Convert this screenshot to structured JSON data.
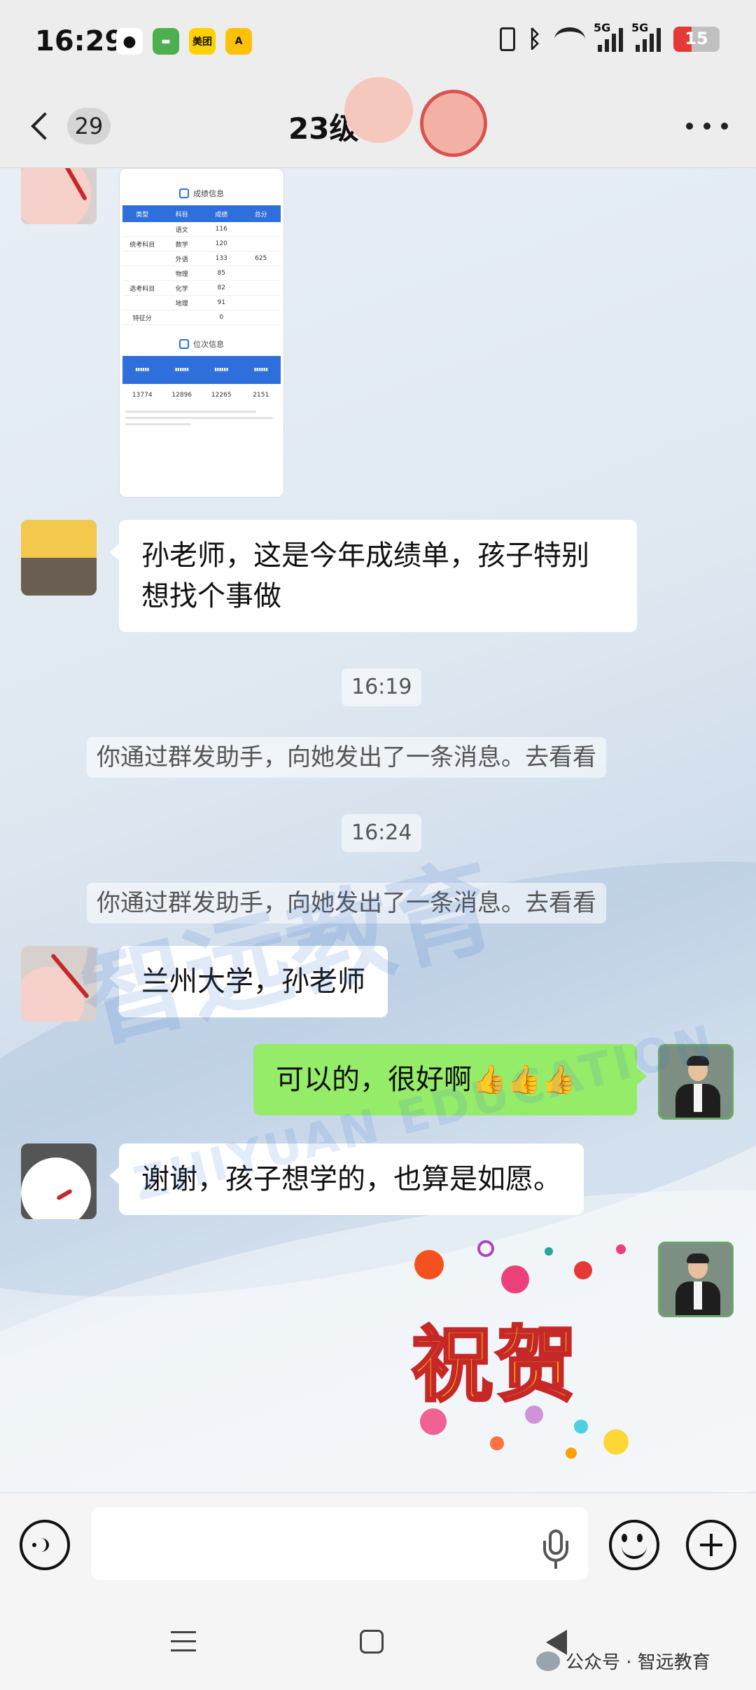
{
  "status_bar": {
    "time": "16:29",
    "apps": [
      "wechat-icon",
      "messages-icon",
      "meituan-icon",
      "app-icon"
    ],
    "meituan_label": "美团",
    "network_1": "5G",
    "network_2": "5G",
    "battery": "15",
    "battery_color": "#e53935"
  },
  "nav": {
    "unread_count": "29",
    "title_partial": "23级"
  },
  "score_sheet": {
    "section_title": "成绩信息",
    "headers": [
      "类型",
      "科目",
      "成绩",
      "总分"
    ],
    "rows": [
      [
        "",
        "语文",
        "116",
        ""
      ],
      [
        "统考科目",
        "数学",
        "120",
        ""
      ],
      [
        "",
        "外语",
        "133",
        "625"
      ],
      [
        "",
        "物理",
        "85",
        ""
      ],
      [
        "选考科目",
        "化学",
        "82",
        ""
      ],
      [
        "",
        "地理",
        "91",
        ""
      ],
      [
        "特征分",
        "",
        "0",
        ""
      ]
    ],
    "rank_title": "位次信息",
    "rank_values": [
      "13774",
      "12896",
      "12265",
      "2151"
    ]
  },
  "messages": [
    {
      "type": "in",
      "text": "孙老师，这是今年成绩单，孩子特别想找个事做"
    },
    {
      "type": "time",
      "text": "16:19"
    },
    {
      "type": "system",
      "text": "你通过群发助手，向她发出了一条消息。去看看"
    },
    {
      "type": "time",
      "text": "16:24"
    },
    {
      "type": "system",
      "text": "你通过群发助手，向她发出了一条消息。去看看"
    },
    {
      "type": "in",
      "text": "兰州大学，孙老师"
    },
    {
      "type": "out",
      "text": "可以的，很好啊👍👍👍"
    },
    {
      "type": "in",
      "text": "谢谢，孩子想学的，也算是如愿。"
    },
    {
      "type": "sticker",
      "text": "祝贺"
    }
  ],
  "watermark": {
    "main": "智远教育",
    "sub": "ZHIYUAN EDUCATION"
  },
  "input_bar": {
    "value": ""
  },
  "footer": {
    "credit": "公众号 · 智远教育"
  }
}
